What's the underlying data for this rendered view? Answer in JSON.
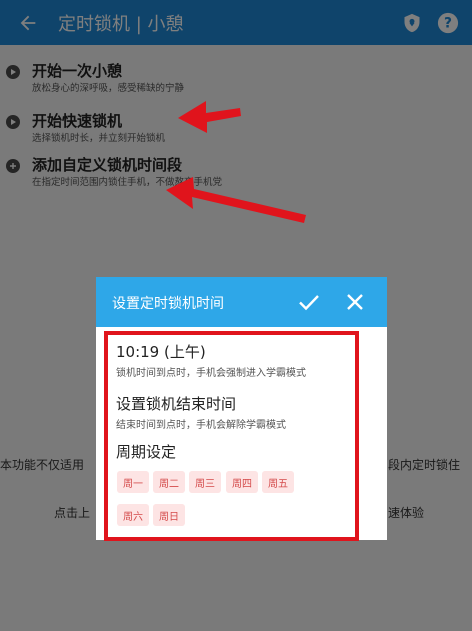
{
  "appbar": {
    "title": "定时锁机 | 小憩",
    "back_icon": "arrow-left-icon",
    "actions": [
      "shield-location-icon",
      "help-icon"
    ],
    "color": "#1e88d6"
  },
  "list": [
    {
      "title": "开始一次小憩",
      "subtitle": "放松身心的深呼吸，感受稀缺的宁静"
    },
    {
      "title": "开始快速锁机",
      "subtitle": "选择锁机时长，并立刻开始锁机"
    },
    {
      "title": "添加自定义锁机时间段",
      "subtitle": "在指定时间范围内锁住手机，不做熬夜手机党"
    }
  ],
  "background": {
    "line1_left": "本功能不仅适用",
    "line1_right": "段内定时锁住",
    "line2_left": "点击上",
    "line2_right": "速体验"
  },
  "dialog": {
    "title": "设置定时锁机时间",
    "header_color": "#2ea7e8",
    "start": {
      "title": "10:19 (上午)",
      "subtitle": "锁机时间到点时，手机会强制进入学霸模式"
    },
    "end": {
      "title": "设置锁机结束时间",
      "subtitle": "结束时间到点时，手机会解除学霸模式"
    },
    "period": {
      "title": "周期设定"
    },
    "days": [
      "周一",
      "周二",
      "周三",
      "周四",
      "周五",
      "周六",
      "周日"
    ]
  }
}
